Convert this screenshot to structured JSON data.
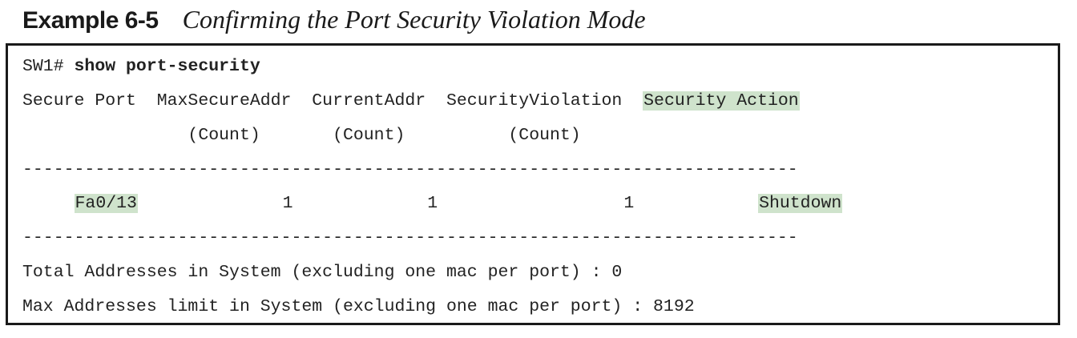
{
  "caption": {
    "label": "Example 6-5",
    "title": "Confirming the Port Security Violation Mode"
  },
  "cli": {
    "prompt": "SW1# ",
    "command": "show port-security",
    "header_pre": "Secure Port  MaxSecureAddr  CurrentAddr  SecurityViolation  ",
    "header_action": "Security Action",
    "subheader": "                (Count)       (Count)          (Count)",
    "divider": "---------------------------------------------------------------------------",
    "row_indent": "     ",
    "row_port": "Fa0/13",
    "row_middle": "              1             1                  1            ",
    "row_action": "Shutdown",
    "total_line": "Total Addresses in System (excluding one mac per port) : 0",
    "max_line": "Max Addresses limit in System (excluding one mac per port) : 8192"
  },
  "colors": {
    "highlight": "#cfe3cc",
    "text": "#222222",
    "border": "#1a1a1a"
  }
}
